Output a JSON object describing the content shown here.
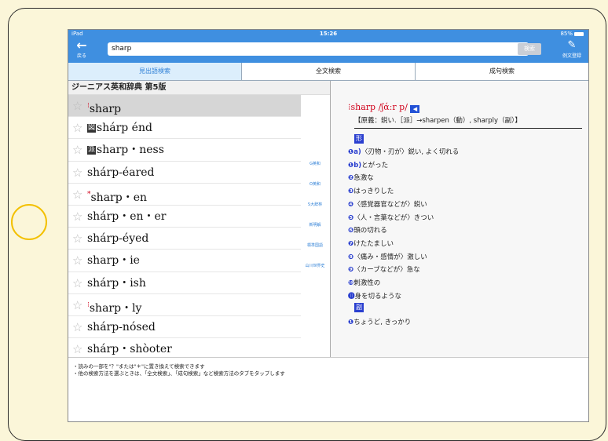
{
  "status_bar": {
    "device": "iPad",
    "time": "15:26",
    "battery": "85%"
  },
  "toolbar": {
    "back_label": "戻る",
    "search_value": "sharp",
    "search_button": "検索",
    "register_label": "例文登録"
  },
  "tabs": [
    {
      "label": "見出語検索",
      "active": true
    },
    {
      "label": "全文検索",
      "active": false
    },
    {
      "label": "成句検索",
      "active": false
    }
  ],
  "list": {
    "header": "ジーニアス英和辞典 第5版",
    "items": [
      {
        "word": "sharp",
        "prefix": "",
        "mark": "⁝",
        "selected": true
      },
      {
        "word": "shárp énd",
        "prefix": "図",
        "mark": "",
        "selected": false
      },
      {
        "word": "sharp・ness",
        "prefix": "派",
        "mark": "",
        "selected": false
      },
      {
        "word": "shárp‐éared",
        "prefix": "",
        "mark": "",
        "selected": false
      },
      {
        "word": "sharp・en",
        "prefix": "",
        "mark": "*",
        "selected": false
      },
      {
        "word": "shárp・en・er",
        "prefix": "",
        "mark": "",
        "selected": false
      },
      {
        "word": "shárp‐éyed",
        "prefix": "",
        "mark": "",
        "selected": false
      },
      {
        "word": "sharp・ie",
        "prefix": "",
        "mark": "",
        "selected": false
      },
      {
        "word": "shárp・ish",
        "prefix": "",
        "mark": "",
        "selected": false
      },
      {
        "word": "sharp・ly",
        "prefix": "",
        "mark": "⁝",
        "selected": false
      },
      {
        "word": "shárp‐nósed",
        "prefix": "",
        "mark": "",
        "selected": false
      },
      {
        "word": "shárp・shòoter",
        "prefix": "",
        "mark": "",
        "selected": false
      }
    ]
  },
  "dict_links": [
    "G英和",
    "O英和",
    "S大辞林",
    "新明解",
    "標準国語",
    "山川世界史"
  ],
  "definition": {
    "headword": "⁝sharp /ʃάːr p/",
    "etymology": "【原義：鋭い.［派］→sharpen（動）, sharply（副）】",
    "pos_adjective": "形",
    "pos_adverb": "副",
    "senses": [
      {
        "num": "❶a)",
        "text": "〈刃物・刃が〉鋭い, よく切れる"
      },
      {
        "num": "❶b)",
        "text": "とがった"
      },
      {
        "num": "❷",
        "text": "急激な"
      },
      {
        "num": "❸",
        "text": "はっきりした"
      },
      {
        "num": "❹",
        "text": "〈感覚器官などが〉鋭い"
      },
      {
        "num": "❺",
        "text": "〈人・言葉などが〉きつい"
      },
      {
        "num": "❻",
        "text": "頭の切れる"
      },
      {
        "num": "❼",
        "text": "けたたましい"
      },
      {
        "num": "❽",
        "text": "〈痛み・感情が〉激しい"
      },
      {
        "num": "❾",
        "text": "〈カーブなどが〉急な"
      },
      {
        "num": "❿",
        "text": "刺激性の"
      },
      {
        "num": "⓫",
        "text": "身を切るような"
      }
    ],
    "adverb_senses": [
      {
        "num": "❶",
        "text": "ちょうど, きっかり"
      }
    ]
  },
  "footer": {
    "hint1": "・読みの一部を\"？\"または\"＊\"に置き換えて検索できます",
    "hint2": "・他の検索方法を選ぶときは、「全文検索」、「成句検索」など検索方法のタブをタップします"
  },
  "colors": {
    "accent": "#3f8fe0",
    "background": "#fbf6d9",
    "headword": "#d0021b",
    "sense_number": "#2a3fcf"
  }
}
